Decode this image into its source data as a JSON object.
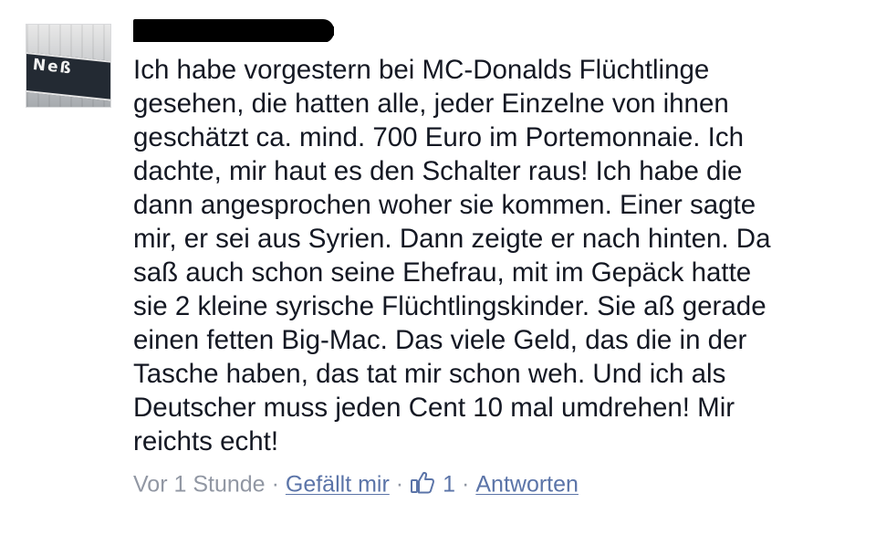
{
  "comment": {
    "avatar": {
      "icon": "profile-photo-street-sign",
      "sign_text": "Neß"
    },
    "author_name": "",
    "body_lines": [
      "Ich habe vorgestern bei MC-Donalds Flüchtlinge",
      "gesehen, die hatten alle, jeder Einzelne von ihnen",
      "geschätzt ca. mind. 700 Euro im Portemonnaie. Ich",
      "dachte, mir haut es den Schalter raus! Ich habe die",
      "dann angesprochen woher sie kommen. Einer sagte",
      "mir, er sei aus Syrien. Dann zeigte er nach hinten. Da",
      "saß auch schon seine Ehefrau, mit im Gepäck hatte",
      "sie 2 kleine syrische Flüchtlingskinder. Sie aß gerade",
      "einen fetten Big-Mac. Das viele Geld, das die in der",
      "Tasche haben, das tat mir schon weh. Und ich als",
      "Deutscher muss jeden Cent 10 mal umdrehen! Mir",
      "reichts echt!"
    ],
    "meta": {
      "timestamp": "Vor 1 Stunde",
      "separator": "·",
      "like_label": "Gefällt mir",
      "like_icon": "thumbs-up-icon",
      "like_count": "1",
      "reply_label": "Antworten"
    },
    "colors": {
      "text": "#141823",
      "meta_text": "#9197a3",
      "link": "#5b74a8",
      "background": "#ffffff"
    }
  }
}
